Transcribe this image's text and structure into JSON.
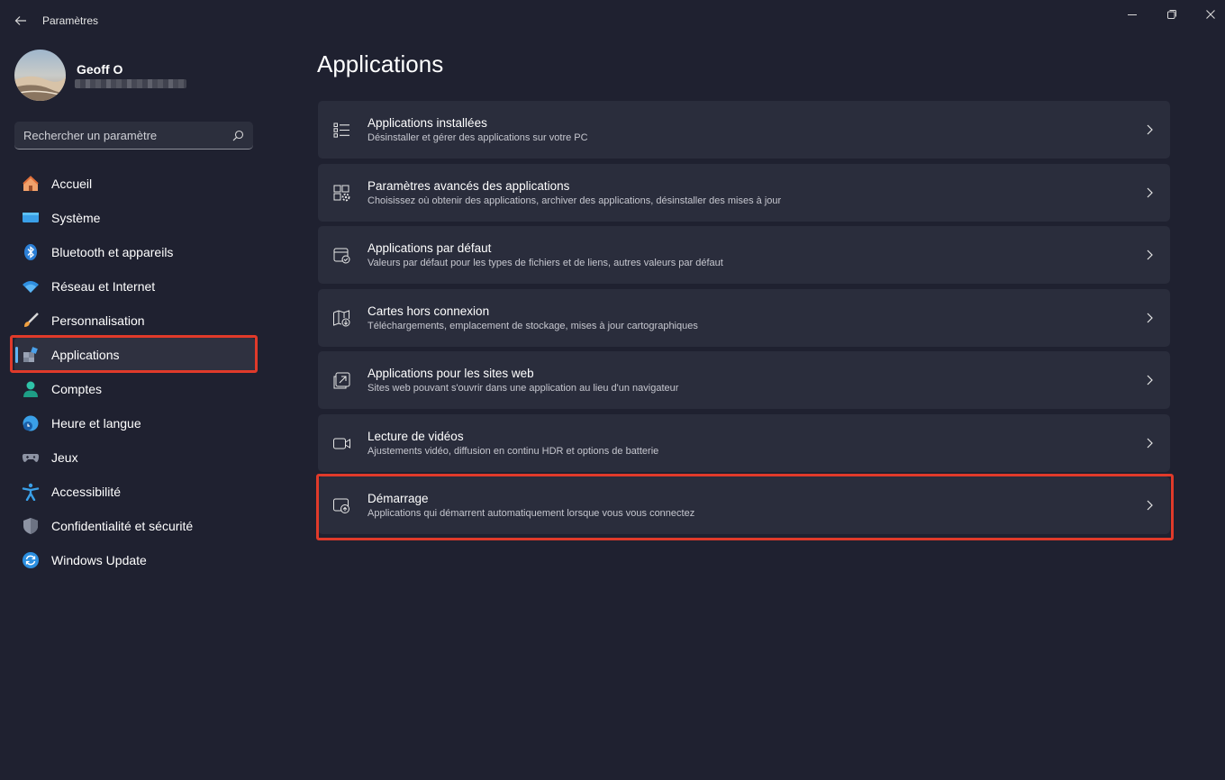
{
  "window": {
    "title": "Paramètres"
  },
  "profile": {
    "name": "Geoff O"
  },
  "search": {
    "placeholder": "Rechercher un paramètre"
  },
  "sidebar": {
    "items": [
      {
        "label": "Accueil",
        "icon": "home-icon"
      },
      {
        "label": "Système",
        "icon": "monitor-icon"
      },
      {
        "label": "Bluetooth et appareils",
        "icon": "bluetooth-icon"
      },
      {
        "label": "Réseau et Internet",
        "icon": "wifi-icon"
      },
      {
        "label": "Personnalisation",
        "icon": "brush-icon"
      },
      {
        "label": "Applications",
        "icon": "apps-icon",
        "selected": true
      },
      {
        "label": "Comptes",
        "icon": "account-icon"
      },
      {
        "label": "Heure et langue",
        "icon": "clock-globe-icon"
      },
      {
        "label": "Jeux",
        "icon": "gamepad-icon"
      },
      {
        "label": "Accessibilité",
        "icon": "accessibility-icon"
      },
      {
        "label": "Confidentialité et sécurité",
        "icon": "shield-icon"
      },
      {
        "label": "Windows Update",
        "icon": "update-icon"
      }
    ]
  },
  "main": {
    "title": "Applications",
    "cards": [
      {
        "title": "Applications installées",
        "subtitle": "Désinstaller et gérer des applications sur votre PC",
        "icon": "list-icon"
      },
      {
        "title": "Paramètres avancés des applications",
        "subtitle": "Choisissez où obtenir des applications, archiver des applications, désinstaller des mises à jour",
        "icon": "apps-settings-icon"
      },
      {
        "title": "Applications par défaut",
        "subtitle": "Valeurs par défaut pour les types de fichiers et de liens, autres valeurs par défaut",
        "icon": "default-apps-icon"
      },
      {
        "title": "Cartes hors connexion",
        "subtitle": "Téléchargements, emplacement de stockage, mises à jour cartographiques",
        "icon": "map-download-icon"
      },
      {
        "title": "Applications pour les sites web",
        "subtitle": "Sites web pouvant s'ouvrir dans une application au lieu d'un navigateur",
        "icon": "open-link-icon"
      },
      {
        "title": "Lecture de vidéos",
        "subtitle": "Ajustements vidéo, diffusion en continu HDR et options de batterie",
        "icon": "video-camera-icon"
      },
      {
        "title": "Démarrage",
        "subtitle": "Applications qui démarrent automatiquement lorsque vous vous connectez",
        "icon": "startup-icon"
      }
    ]
  },
  "colors": {
    "background": "#1f2130",
    "card": "#2a2d3c",
    "accent": "#60b4f4",
    "highlight": "#e03a2a"
  }
}
